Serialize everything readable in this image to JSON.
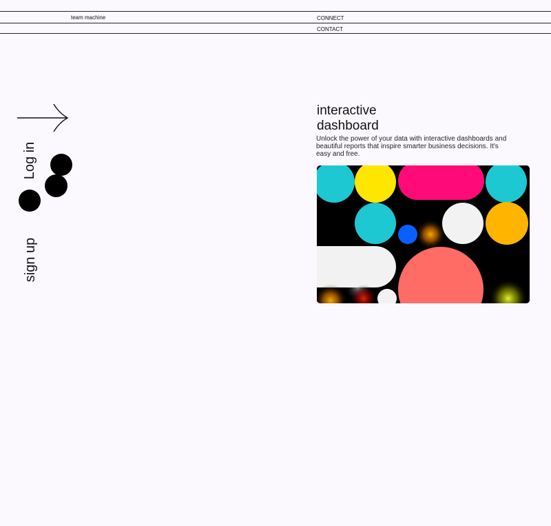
{
  "nav": {
    "brand": "team machine",
    "connect": "CONNECT",
    "contact": "CONTACT"
  },
  "side": {
    "arrow_icon": "arrow-right-icon",
    "login": "Log in",
    "signup": "sign up"
  },
  "hero": {
    "title_line1": "interactive",
    "title_line2": "dashboard",
    "description": "Unlock the power of your data with interactive dashboards and beautiful reports that inspire smarter business decisions. It's easy and free."
  },
  "colors": {
    "background": "#fbf9fe",
    "cyan": "#1ec8d2",
    "yellow": "#ffe600",
    "pink": "#ff0a78",
    "white_shape": "#f2f2f2",
    "orange": "#ffb400",
    "blue": "#0a5fff",
    "coral": "#ff6b65"
  }
}
